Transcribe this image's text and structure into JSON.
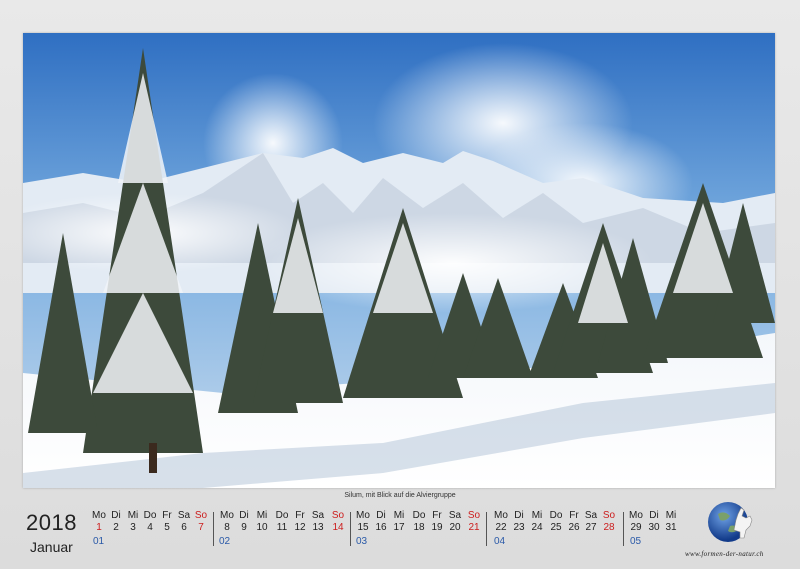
{
  "caption": "Silum, mit Blick auf die Alviergruppe",
  "year": "2018",
  "month": "Januar",
  "website": "www.formen-der-natur.ch",
  "colors": {
    "sunday": "#cc1d1d",
    "week_number": "#2b5aa8"
  },
  "calendar": {
    "day_names": [
      "Mo",
      "Di",
      "Mi",
      "Do",
      "Fr",
      "Sa",
      "So",
      "Mo",
      "Di",
      "Mi",
      "Do",
      "Fr",
      "Sa",
      "So",
      "Mo",
      "Di",
      "Mi",
      "Do",
      "Fr",
      "Sa",
      "So",
      "Mo",
      "Di",
      "Mi",
      "Do",
      "Fr",
      "Sa",
      "So",
      "Mo",
      "Di",
      "Mi"
    ],
    "days": [
      "1",
      "2",
      "3",
      "4",
      "5",
      "6",
      "7",
      "8",
      "9",
      "10",
      "11",
      "12",
      "13",
      "14",
      "15",
      "16",
      "17",
      "18",
      "19",
      "20",
      "21",
      "22",
      "23",
      "24",
      "25",
      "26",
      "27",
      "28",
      "29",
      "30",
      "31"
    ],
    "weeks": [
      "01",
      "02",
      "03",
      "04",
      "05"
    ]
  },
  "icons": {
    "logo": "globe-ibex-logo-icon"
  }
}
